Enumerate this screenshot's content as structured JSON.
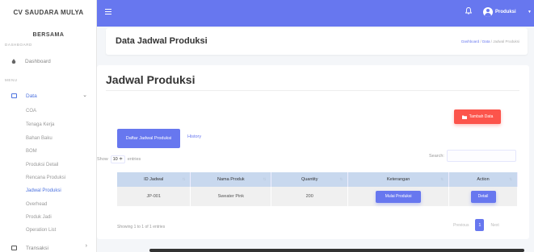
{
  "app": {
    "brand_line1": "CV SAUDARA MULYA",
    "brand_line2": "BERSAMA"
  },
  "sidebar": {
    "section_dashboard": "DASHBOARD",
    "dashboard_label": "Dashboard",
    "section_menu": "MENU",
    "data_label": "Data",
    "sub_items": [
      "COA",
      "Tenaga Kerja",
      "Bahan Baku",
      "BOM",
      "Produksi Detail",
      "Rencana Produksi",
      "Jadwal Produksi",
      "Overhead",
      "Produk Jadi",
      "Operation List"
    ],
    "active_sub": "Jadwal Produksi",
    "transaksi_label": "Transaksi"
  },
  "topbar": {
    "user_name": "Produksi",
    "accent": "#6777ef"
  },
  "header": {
    "title": "Data Jadwal Produksi",
    "crumb_1": "Dashboard",
    "crumb_sep1": " / ",
    "crumb_2": "Data",
    "crumb_sep2": " / ",
    "crumb_3": "Jadwal Produksi"
  },
  "main": {
    "title": "Jadwal Produksi",
    "add_button": "Tambah Data",
    "tab_active": "Daftar Jadwal Produksi",
    "tab_history": "History",
    "show_label": "Show",
    "entries_value": "10 ≑",
    "entries_label": "entries",
    "search_label": "Search:",
    "columns": [
      "ID Jadwal",
      "Nama Produk",
      "Quantity",
      "Keterangan",
      "Action"
    ],
    "rows": [
      {
        "id": "JP-001",
        "produk": "Sweater Pink",
        "qty": "200",
        "ket_button": "Mulai Produksi",
        "action_button": "Detail"
      }
    ],
    "showing": "Showing 1 to 1 of 1 entries",
    "pager_prev": "Previous",
    "pager_page": "1",
    "pager_next": "Next"
  },
  "colors": {
    "primary": "#6777ef",
    "danger": "#fc544b",
    "table_head": "#c8d8ee"
  }
}
